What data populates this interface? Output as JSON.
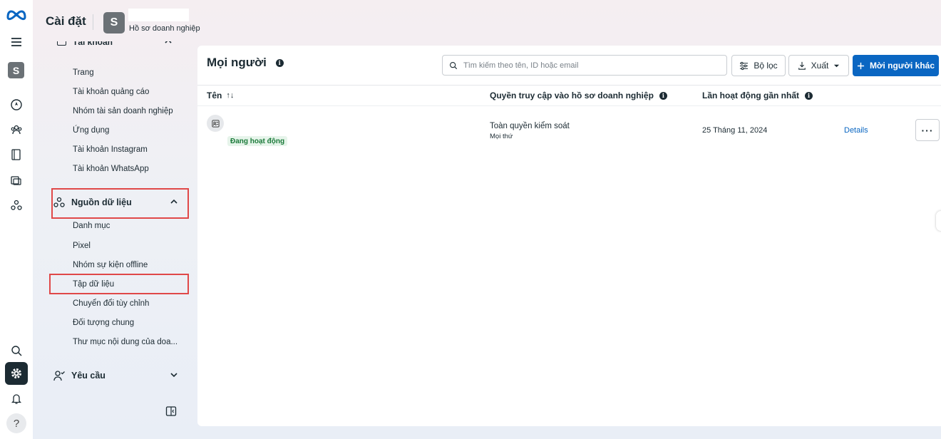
{
  "header": {
    "title": "Cài đặt",
    "business_avatar": "S",
    "business_subtitle": "Hồ sơ doanh nghiệp"
  },
  "rail": {
    "avatar": "S",
    "help": "?"
  },
  "sidebar": {
    "section_accounts": {
      "label": "Tài khoản",
      "items": [
        "Trang",
        "Tài khoản quảng cáo",
        "Nhóm tài sản doanh nghiệp",
        "Ứng dụng",
        "Tài khoản Instagram",
        "Tài khoản WhatsApp"
      ]
    },
    "section_data_sources": {
      "label": "Nguồn dữ liệu",
      "items": [
        "Danh mục",
        "Pixel",
        "Nhóm sự kiện offline",
        "Tập dữ liệu",
        "Chuyển đổi tùy chỉnh",
        "Đối tượng chung",
        "Thư mục nội dung của doa..."
      ]
    },
    "section_requests": {
      "label": "Yêu cầu"
    }
  },
  "main": {
    "title": "Mọi người",
    "search_placeholder": "Tìm kiếm theo tên, ID hoặc email",
    "filter_label": "Bộ lọc",
    "export_label": "Xuất",
    "invite_label": "Mời người khác",
    "columns": {
      "name": "Tên",
      "sort_glyph": "↑↓",
      "access": "Quyền truy cập vào hồ sơ doanh nghiệp",
      "last_active": "Lần hoạt động gần nhất"
    },
    "rows": [
      {
        "status": "Đang hoạt động",
        "access": "Toàn quyền kiểm soát",
        "access_scope": "Mọi thứ",
        "last_active": "25 Tháng 11, 2024",
        "details": "Details",
        "more": "···"
      }
    ]
  },
  "colors": {
    "primary": "#0a66c2",
    "highlight": "#e04848",
    "status_green": "#1b7a3a"
  }
}
